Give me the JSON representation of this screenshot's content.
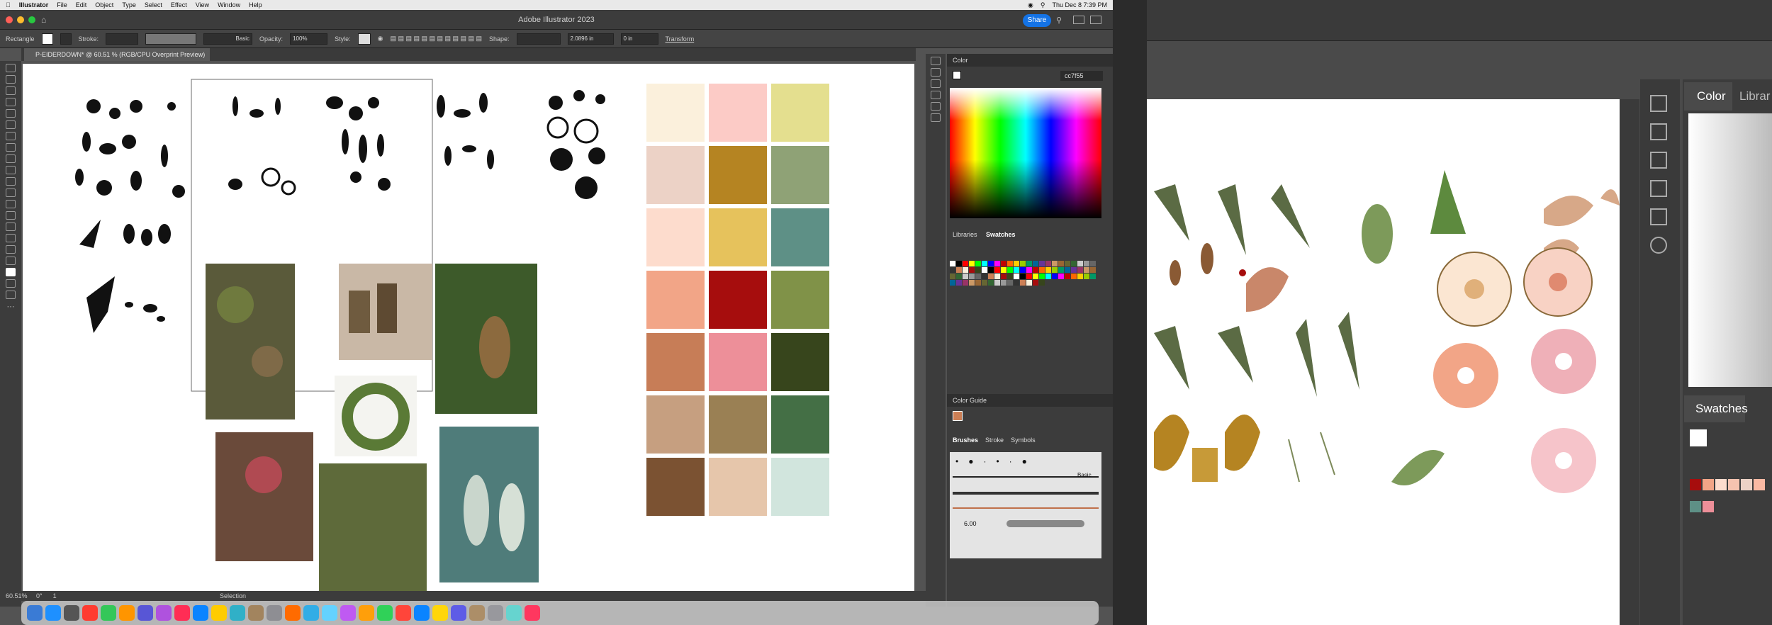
{
  "menubar": {
    "app": "Illustrator",
    "items": [
      "File",
      "Edit",
      "Object",
      "Type",
      "Select",
      "Effect",
      "View",
      "Window",
      "Help"
    ],
    "datetime": "Thu Dec 8  7:39 PM"
  },
  "titlebar": {
    "title": "Adobe Illustrator 2023",
    "share_label": "Share"
  },
  "control_bar": {
    "object_type": "Rectangle",
    "stroke_label": "Stroke:",
    "stroke_style": "Basic",
    "opacity_label": "Opacity:",
    "opacity_value": "100%",
    "style_label": "Style:",
    "shape_label": "Shape:",
    "width_value": "2.0896 in",
    "height_value": "0 in",
    "transform_label": "Transform"
  },
  "document_tab": {
    "label": "P-EIDERDOWN* @ 60.51 % (RGB/CPU Overprint Preview)"
  },
  "statusbar": {
    "zoom": "60.51%",
    "rotation": "0°",
    "artboard": "1",
    "tool": "Selection"
  },
  "panels": {
    "color": {
      "title": "Color",
      "hex": "cc7f55"
    },
    "libraries_tab": "Libraries",
    "swatches_tab": "Swatches",
    "color_guide": "Color Guide",
    "brushes_tab": "Brushes",
    "stroke_tab": "Stroke",
    "symbols_tab": "Symbols",
    "brush_basic": "Basic",
    "brush_size": "6.00"
  },
  "palette": {
    "columns": [
      [
        "#fbf0dc",
        "#ecd2c6",
        "#fddccd",
        "#f2a587",
        "#c77d57",
        "#c69f80",
        "#7b5232"
      ],
      [
        "#fccbc6",
        "#b58422",
        "#e6c25c",
        "#a60d0d",
        "#ed8f99",
        "#9a8054",
        "#e6c6ab"
      ],
      [
        "#e4df8f",
        "#8fa276",
        "#5e9086",
        "#809248",
        "#37451c",
        "#446f45",
        "#d1e5dd"
      ]
    ]
  },
  "swatch_colors": [
    "#ffffff",
    "#000000",
    "#ff0000",
    "#ffff00",
    "#00ff00",
    "#00ffff",
    "#0000ff",
    "#ff00ff",
    "#c00000",
    "#ff6600",
    "#ffcc00",
    "#99cc00",
    "#009966",
    "#006699",
    "#663399",
    "#993366",
    "#cc9966",
    "#996633",
    "#666633",
    "#336633",
    "#cccccc",
    "#999999",
    "#666666",
    "#333333",
    "#cc7f55",
    "#fbf0dc",
    "#a60d0d",
    "#37451c"
  ],
  "right_panel": {
    "color_tab": "Color",
    "libraries_tab": "Librar",
    "swatches_tab": "Swatches",
    "swatch_colors": [
      "#a60d0d",
      "#f2a587",
      "#fddccd",
      "#f6c3b0",
      "#ecd2c6",
      "#f9b9a3",
      "#5e9086",
      "#ed8f99"
    ]
  }
}
